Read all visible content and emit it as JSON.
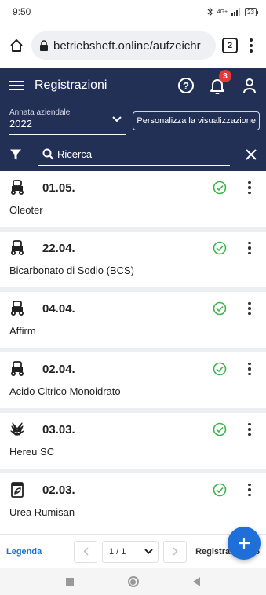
{
  "status_bar": {
    "time": "9:50",
    "network": "4G+",
    "battery": "23"
  },
  "browser": {
    "url": "betriebsheft.online/aufzeichr",
    "tabs_count": "2"
  },
  "app_bar": {
    "title": "Registrazioni",
    "notification_count": "3"
  },
  "filters": {
    "year_label": "Annata aziendale",
    "year_value": "2022",
    "customize_label": "Personalizza la visualizzazione",
    "search_placeholder": "Ricerca"
  },
  "records": [
    {
      "date": "01.05.",
      "name": "Oleoter",
      "icon": "tractor-icon"
    },
    {
      "date": "22.04.",
      "name": "Bicarbonato di Sodio (BCS)",
      "icon": "tractor-icon"
    },
    {
      "date": "04.04.",
      "name": "Affirm",
      "icon": "tractor-icon"
    },
    {
      "date": "02.04.",
      "name": "Acido Citrico Monoidrato",
      "icon": "tractor-icon"
    },
    {
      "date": "03.03.",
      "name": "Hereu SC",
      "icon": "plant-icon"
    },
    {
      "date": "02.03.",
      "name": "Urea Rumisan",
      "icon": "fertilizer-bag-icon"
    }
  ],
  "footer": {
    "legend_label": "Legenda",
    "page_value": "1 / 1",
    "records_label": "Registrazioni: 6"
  },
  "colors": {
    "primary": "#223056",
    "accent": "#1e6fd9",
    "success": "#3bb54a",
    "badge": "#e53935"
  }
}
